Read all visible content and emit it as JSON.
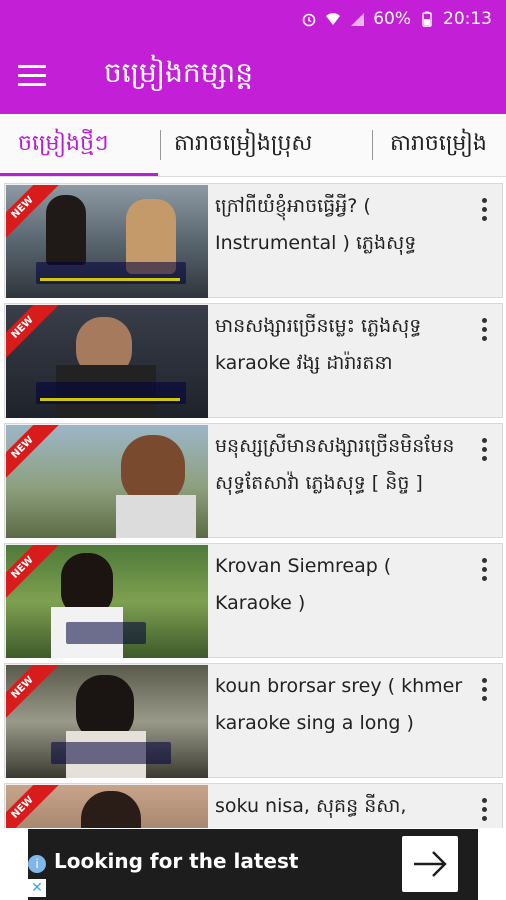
{
  "status": {
    "battery": "60%",
    "time": "20:13"
  },
  "app": {
    "title": "ចម្រៀងកម្សាន្ត"
  },
  "tabs": [
    {
      "label": "ចម្រៀងថ្មីៗ"
    },
    {
      "label": "តារាចម្រៀងប្រុស"
    },
    {
      "label": "តារាចម្រៀង"
    }
  ],
  "videos": [
    {
      "badge": "NEW",
      "title": "ក្រៅពីយំខ្ញុំអាចធ្វើអ្វី? ( Instrumental ) ភ្លេងសុទ្ធ"
    },
    {
      "badge": "NEW",
      "title": "មានសង្សារច្រើនម្លេះ ភ្លេងសុទ្ធ karaoke វង្ស ដារ៉ារតនា"
    },
    {
      "badge": "NEW",
      "title": "មនុស្សស្រីមានសង្សារច្រើនមិនមែនសុទ្ធតែសាវ៉ា ភ្លេងសុទ្ធ [ និច្ច ]"
    },
    {
      "badge": "NEW",
      "title": "Krovan Siemreap ( Karaoke )"
    },
    {
      "badge": "NEW",
      "title": "koun brorsar srey ( khmer karaoke sing a long )"
    },
    {
      "badge": "NEW",
      "title": "soku nisa, សុគន្ធ នីសា,"
    }
  ],
  "ad": {
    "text": "Looking for the latest"
  }
}
